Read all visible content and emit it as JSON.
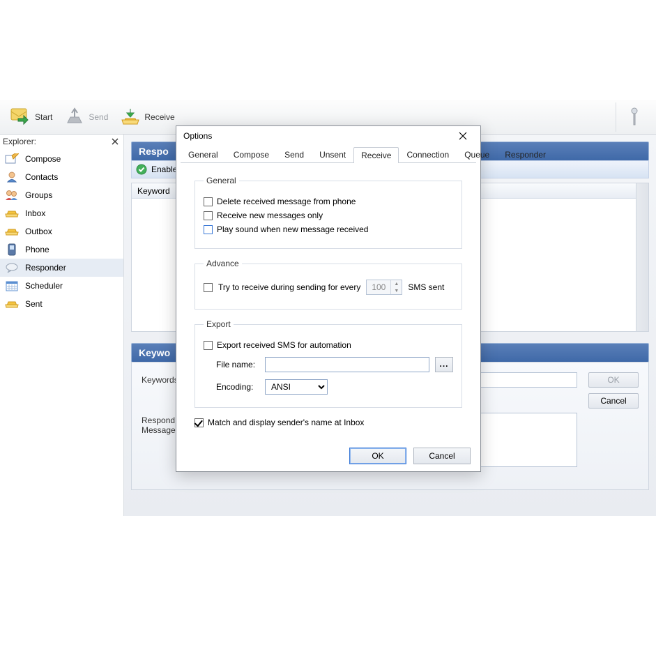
{
  "toolbar": {
    "start": "Start",
    "send": "Send",
    "receive": "Receive"
  },
  "explorer": {
    "title": "Explorer:",
    "items": [
      {
        "id": "compose",
        "label": "Compose"
      },
      {
        "id": "contacts",
        "label": "Contacts"
      },
      {
        "id": "groups",
        "label": "Groups"
      },
      {
        "id": "inbox",
        "label": "Inbox"
      },
      {
        "id": "outbox",
        "label": "Outbox"
      },
      {
        "id": "phone",
        "label": "Phone"
      },
      {
        "id": "responder",
        "label": "Responder"
      },
      {
        "id": "scheduler",
        "label": "Scheduler"
      },
      {
        "id": "sent",
        "label": "Sent"
      }
    ],
    "selected": "responder"
  },
  "main": {
    "responder_title_partial": "Respo",
    "enable_partial": "Enable",
    "keyword_col_partial": "Keyword",
    "keyword_props_title_partial": "Keywo",
    "keywords_label_partial": "Keywords",
    "respond_label_line1": "Respond",
    "respond_label_line2": "Message",
    "ok_btn": "OK",
    "cancel_btn": "Cancel"
  },
  "dialog": {
    "title": "Options",
    "tabs": [
      "General",
      "Compose",
      "Send",
      "Unsent",
      "Receive",
      "Connection",
      "Queue",
      "Responder"
    ],
    "active_tab": "Receive",
    "general": {
      "legend": "General",
      "delete_received": "Delete received message from phone",
      "receive_new_only": "Receive new messages only",
      "play_sound": "Play sound when new message received"
    },
    "advance": {
      "legend": "Advance",
      "try_receive_label": "Try to receive during sending for every",
      "spin_value": "100",
      "sms_sent": "SMS sent"
    },
    "export": {
      "legend": "Export",
      "export_sms": "Export received SMS for automation",
      "file_name_label": "File name:",
      "file_name_value": "",
      "browse": "...",
      "encoding_label": "Encoding:",
      "encoding_value": "ANSI"
    },
    "match_display": "Match and display sender's name at Inbox",
    "ok": "OK",
    "cancel": "Cancel"
  }
}
